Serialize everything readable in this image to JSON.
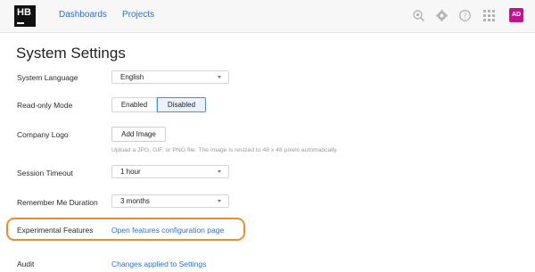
{
  "topbar": {
    "logo_text": "HB",
    "nav": {
      "dashboards": "Dashboards",
      "projects": "Projects"
    },
    "icons": [
      "search-icon",
      "gear-icon",
      "help-icon",
      "apps-grid-icon"
    ],
    "avatar_initials": "AD",
    "accent_color": "#c0138e"
  },
  "page": {
    "title": "System Settings",
    "system_language": {
      "label": "System Language",
      "value": "English"
    },
    "read_only_mode": {
      "label": "Read-only Mode",
      "options": [
        "Enabled",
        "Disabled"
      ],
      "selected": "Disabled"
    },
    "company_logo": {
      "label": "Company Logo",
      "button": "Add Image",
      "hint": "Upload a JPG, GIF, or PNG file. The image is resized to 48 x 48 pixels automatically."
    },
    "session_timeout": {
      "label": "Session Timeout",
      "value": "1 hour"
    },
    "remember_me": {
      "label": "Remember Me Duration",
      "value": "3 months"
    },
    "experimental": {
      "label": "Experimental Features",
      "link": "Open features configuration page"
    },
    "audit": {
      "label": "Audit",
      "link": "Changes applied to Settings"
    }
  },
  "colors": {
    "link": "#2f6fca",
    "highlight": "#f08c2d",
    "selected_border": "#4a90d9"
  }
}
